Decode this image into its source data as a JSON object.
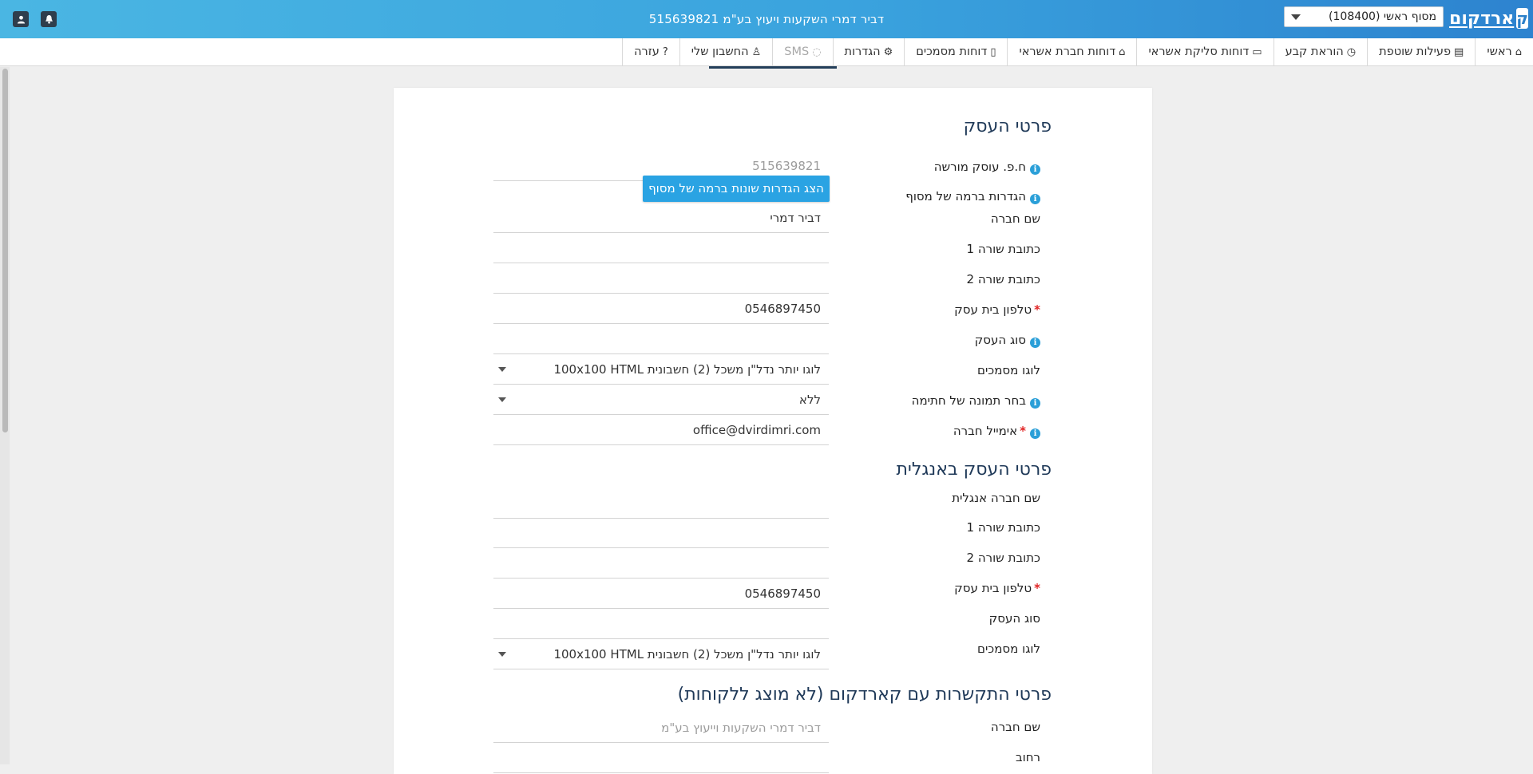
{
  "topbar": {
    "title": "דביר דמרי השקעות ויעוץ בע\"מ 515639821",
    "terminal_select": "מסוף ראשי (108400)",
    "logo_text": "ארדקום",
    "logo_mark": "ק",
    "icons": [
      "user-icon",
      "bell-icon"
    ]
  },
  "nav": {
    "items": [
      {
        "label": "ראשי",
        "icon": "home-icon",
        "glyph": "⌂"
      },
      {
        "label": "פעילות שוטפת",
        "icon": "briefcase-icon",
        "glyph": "▤"
      },
      {
        "label": "הוראת קבע",
        "icon": "clock-icon",
        "glyph": "◷"
      },
      {
        "label": "דוחות סליקת אשראי",
        "icon": "credit-card-icon",
        "glyph": "▭"
      },
      {
        "label": "דוחות חברת אשראי",
        "icon": "bank-icon",
        "glyph": "⌂"
      },
      {
        "label": "דוחות מסמכים",
        "icon": "file-icon",
        "glyph": "▯"
      },
      {
        "label": "הגדרות",
        "icon": "gears-icon",
        "glyph": "⚙"
      },
      {
        "label": "SMS",
        "icon": "comment-icon",
        "glyph": "◌"
      },
      {
        "label": "החשבון שלי",
        "icon": "user-tie-icon",
        "glyph": "♙"
      },
      {
        "label": "עזרה",
        "icon": "question-circle-icon",
        "glyph": "?"
      }
    ]
  },
  "business_details": {
    "title": "פרטי העסק",
    "fields": {
      "registered_id": {
        "label": "ח.פ. עוסק מורשה",
        "value": "515639821"
      },
      "terminal_settings": {
        "label": "הגדרות ברמה של מסוף",
        "button": "הצג הגדרות שונות ברמה של מסוף"
      },
      "company_name": {
        "label": "שם חברה",
        "value": "דביר דמרי"
      },
      "address1": {
        "label": "כתובת שורה 1",
        "value": ""
      },
      "address2": {
        "label": "כתובת שורה 2",
        "value": ""
      },
      "phone": {
        "label": "טלפון בית עסק",
        "value": "0546897450"
      },
      "business_type": {
        "label": "סוג העסק",
        "value": ""
      },
      "doc_logo": {
        "label": "לוגו מסמכים",
        "value": "לוגו יותר נדל\"ן משכל (2) חשבונית 100x100 HTML"
      },
      "signature_image": {
        "label": "בחר תמונה של חתימה",
        "value": "ללא"
      },
      "email": {
        "label": "אימייל חברה",
        "value": "office@dvirdimri.com"
      }
    }
  },
  "business_details_en": {
    "title": "פרטי העסק באנגלית",
    "fields": {
      "company_name": {
        "label": "שם חברה אנגלית",
        "value": ""
      },
      "address1": {
        "label": "כתובת שורה 1",
        "value": ""
      },
      "address2": {
        "label": "כתובת שורה 2",
        "value": ""
      },
      "phone": {
        "label": "טלפון בית עסק",
        "value": "0546897450"
      },
      "business_type": {
        "label": "סוג העסק",
        "value": ""
      },
      "doc_logo": {
        "label": "לוגו מסמכים",
        "value": "לוגו יותר נדל\"ן משכל (2) חשבונית 100x100 HTML"
      }
    }
  },
  "contact_details": {
    "title": "פרטי התקשרות עם קארדקום (לא מוצג ללקוחות)",
    "fields": {
      "company_name": {
        "label": "שם חברה",
        "placeholder": "דביר דמרי השקעות וייעוץ בע\"מ"
      },
      "street": {
        "label": "רחוב",
        "value": ""
      }
    }
  }
}
